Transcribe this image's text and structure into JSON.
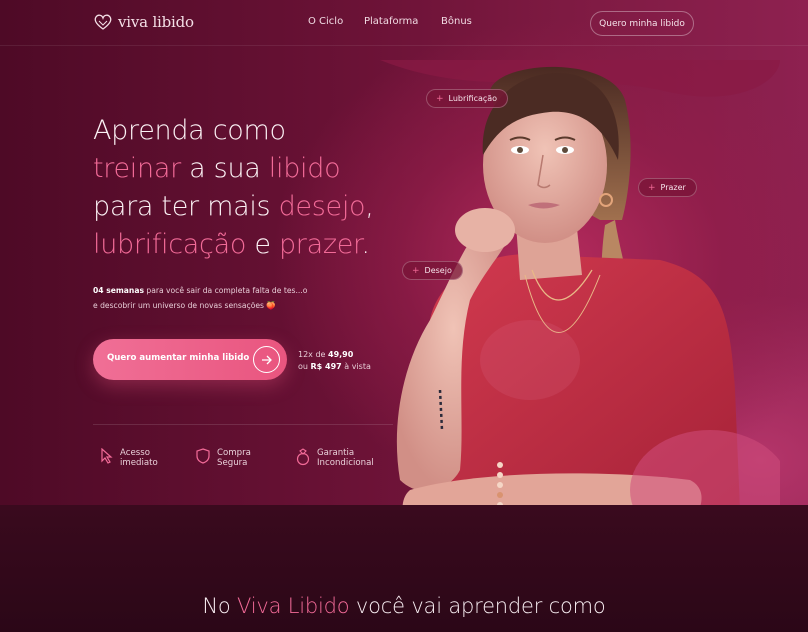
{
  "nav": {
    "logo_text": "viva libido",
    "links": [
      "O Ciclo",
      "Plataforma",
      "Bônus"
    ],
    "cta_label": "Quero minha libido"
  },
  "hero": {
    "headline": {
      "line1": "Aprenda como",
      "line2_hl1": "treinar",
      "line2_mid": " a sua ",
      "line2_hl2": "libido",
      "line3_pre": "para ter mais ",
      "line3_hl": "desejo",
      "line3_post": ",",
      "line4_hl1": "lubrificação",
      "line4_mid": " e ",
      "line4_hl2": "prazer",
      "line4_post": "."
    },
    "sub_bold": "04 semanas",
    "sub_text": " para você sair da completa falta de tes...o",
    "sub_line2": "e descobrir um universo de novas sensações 🍑",
    "cta_label": "Quero aumentar minha libido",
    "price": {
      "installments_prefix": "12x de ",
      "installments_value": "49,90",
      "cash_prefix": "ou ",
      "cash_value": "R$ 497",
      "cash_suffix": " à vista"
    },
    "features": [
      {
        "icon": "cursor-icon",
        "line1": "Acesso",
        "line2": "imediato"
      },
      {
        "icon": "shield-icon",
        "line1": "Compra",
        "line2": "Segura"
      },
      {
        "icon": "ring-icon",
        "line1": "Garantia",
        "line2": "Incondicional"
      }
    ],
    "tags": [
      "Lubrificação",
      "Prazer",
      "Desejo"
    ]
  },
  "section": {
    "title_pre": "No ",
    "title_hl": "Viva Libido",
    "title_post": " você vai aprender como"
  },
  "colors": {
    "accent": "#f26b98",
    "cta": "#ec6088",
    "background": "#5a0e2e"
  }
}
